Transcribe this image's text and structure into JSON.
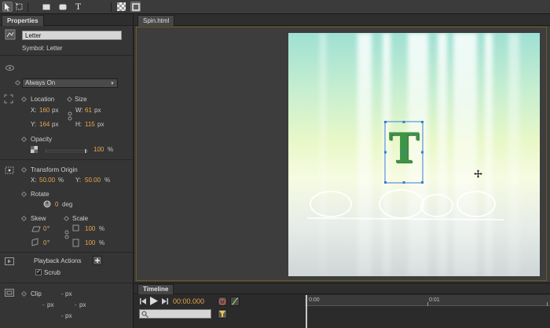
{
  "toolbar": {
    "tools": [
      "select-tool",
      "transform-tool",
      "rectangle-tool",
      "rounded-rectangle-tool",
      "text-tool",
      "stage-transparency-toggle",
      "stage-border-toggle"
    ],
    "text_tool_glyph": "T"
  },
  "properties": {
    "tab_label": "Properties",
    "element_name": "Letter",
    "symbol_label": "Symbol: Letter",
    "display_mode": "Always On",
    "location_label": "Location",
    "size_label": "Size",
    "x_label": "X:",
    "x_value": "160",
    "y_label": "Y:",
    "y_value": "164",
    "w_label": "W:",
    "w_value": "61",
    "h_label": "H:",
    "h_value": "115",
    "px": "px",
    "opacity_label": "Opacity",
    "opacity_value": "100",
    "opacity_fraction": 1.0,
    "percent": "%",
    "transform_origin_label": "Transform Origin",
    "origin_x_value": "50.00",
    "origin_y_value": "50.00",
    "rotate_label": "Rotate",
    "rotate_value": "0",
    "deg": "deg",
    "skew_label": "Skew",
    "scale_label": "Scale",
    "skew_x_value": "0",
    "skew_y_value": "0",
    "degree_sign": "°",
    "scale_x_value": "100",
    "scale_y_value": "100",
    "playback_actions_label": "Playback Actions",
    "scrub_label": "Scrub",
    "scrub_checked": true,
    "clip_label": "Clip",
    "clip_placeholder": "-",
    "colors": {
      "accent_value": "#e8a74a",
      "panel_bg": "#353535"
    }
  },
  "document": {
    "tab_label": "Spin.html",
    "letter": "T",
    "letter_color": "#3d9447",
    "selection_color": "#3a7bd5"
  },
  "timeline": {
    "tab_label": "Timeline",
    "current_time": "00:00.000",
    "ruler_labels": [
      "0:00",
      "0:01"
    ]
  }
}
